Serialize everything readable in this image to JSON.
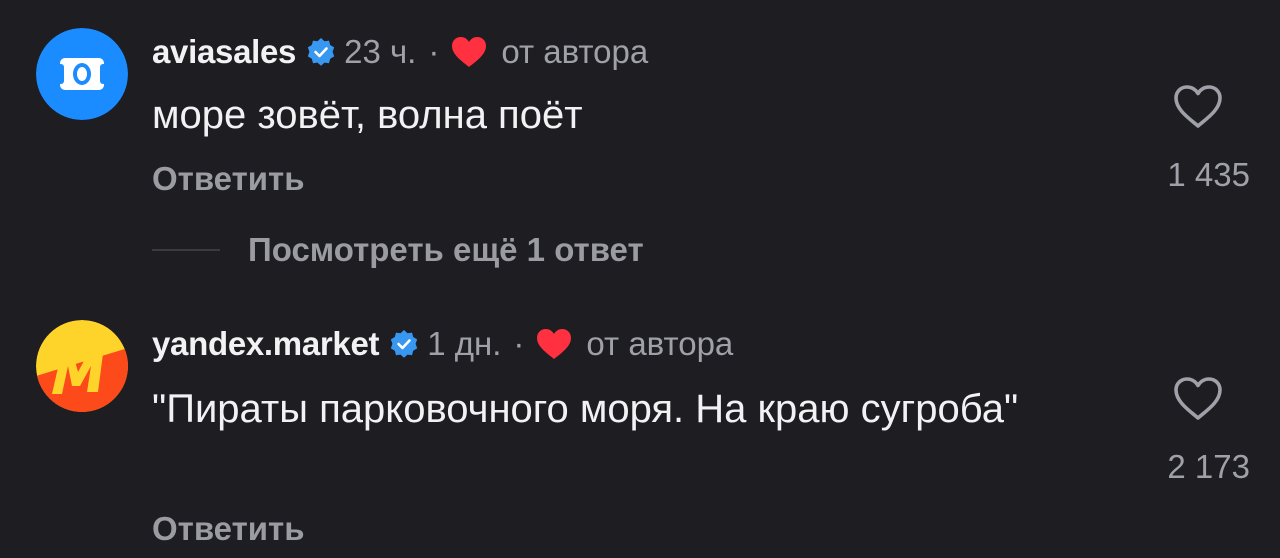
{
  "comments": [
    {
      "username": "aviasales",
      "time": "23 ч.",
      "separator": "·",
      "author_liked": "от автора",
      "text": "море зовёт, волна поёт",
      "reply_label": "Ответить",
      "like_count": "1 435",
      "avatar_color": "#1a8cff"
    },
    {
      "username": "yandex.market",
      "time": "1 дн.",
      "separator": "·",
      "author_liked": "от автора",
      "text": "\"Пираты парковочного моря. На краю сугроба\"",
      "reply_label": "Ответить",
      "like_count": "2 173",
      "avatar_color": "#fed42b"
    }
  ],
  "view_more_replies": "Посмотреть ещё 1 ответ",
  "colors": {
    "background": "#1d1d22",
    "verified_badge": "#3897f0",
    "heart": "#ff3040",
    "secondary_text": "#a0a0a8"
  },
  "icons": {
    "verified": "verified-badge-icon",
    "author_heart": "heart-filled-icon",
    "like": "heart-outline-icon"
  }
}
